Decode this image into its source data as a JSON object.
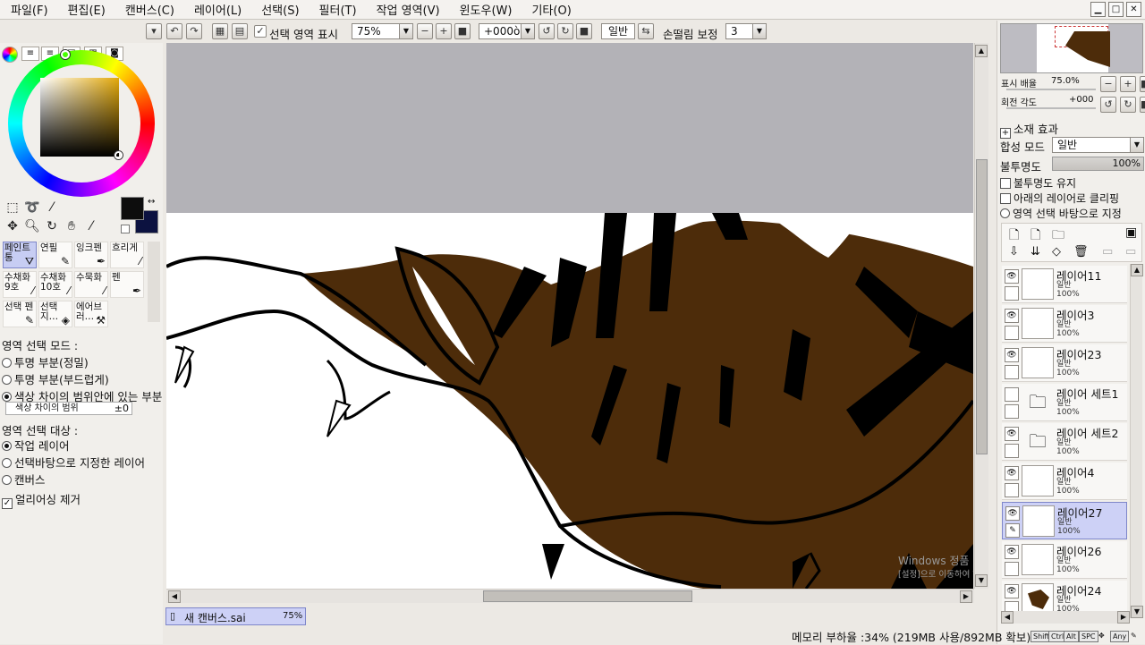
{
  "menu": [
    "파일(F)",
    "편집(E)",
    "캔버스(C)",
    "레이어(L)",
    "선택(S)",
    "필터(T)",
    "작업 영역(V)",
    "윈도우(W)",
    "기타(O)"
  ],
  "toolbar": {
    "show_selection_label": "선택 영역 표시",
    "zoom_value": "75%",
    "rotation_value": "+000ò",
    "blend_value": "일반",
    "stabilizer_label": "손떨림 보정",
    "stabilizer_value": "3"
  },
  "tools": {
    "brushes": [
      {
        "label": "페인트통",
        "icon": "bucket-icon"
      },
      {
        "label": "연필",
        "icon": "pencil-icon"
      },
      {
        "label": "잉크펜",
        "icon": "pen-icon"
      },
      {
        "label": "흐리게",
        "icon": "blur-icon"
      },
      {
        "label": "수채화 9호",
        "icon": "brush-icon"
      },
      {
        "label": "수채화 10호",
        "icon": "brush-icon"
      },
      {
        "label": "수묵화",
        "icon": "brush-icon"
      },
      {
        "label": "펜",
        "icon": "pen-icon"
      },
      {
        "label": "선택 펜",
        "icon": "selpen-icon"
      },
      {
        "label": "선택 지…",
        "icon": "eraser-icon"
      },
      {
        "label": "에어브러…",
        "icon": "airbrush-icon"
      }
    ],
    "selection_mode_title": "영역 선택 모드 :",
    "selection_modes": [
      "투명 부분(정밀)",
      "투명 부분(부드럽게)",
      "색상 차이의 범위안에 있는 부분"
    ],
    "color_range_label": "색상 차이의 범위",
    "color_range_value": "±0",
    "selection_target_title": "영역 선택 대상 :",
    "selection_targets": [
      "작업 레이어",
      "선택바탕으로 지정한 레이어",
      "캔버스"
    ],
    "antialias_label": "얼리어싱 제거"
  },
  "navigator": {
    "zoom_label": "표시 배율",
    "zoom_value": "75.0%",
    "rotation_label": "회전 각도",
    "rotation_value": "+000"
  },
  "layer_panel": {
    "material_effect": "소재 효과",
    "blend_label": "합성 모드",
    "blend_value": "일반",
    "opacity_label": "불투명도",
    "opacity_value": "100%",
    "opt_preserve": "불투명도 유지",
    "opt_clip": "아래의 레이어로 클리핑",
    "opt_source": "영역 선택 바탕으로 지정",
    "layers": [
      {
        "name": "레이어11",
        "mode": "일반",
        "opacity": "100%",
        "visible": true,
        "folder": false
      },
      {
        "name": "레이어3",
        "mode": "일반",
        "opacity": "100%",
        "visible": true,
        "folder": false
      },
      {
        "name": "레이어23",
        "mode": "일반",
        "opacity": "100%",
        "visible": true,
        "folder": false
      },
      {
        "name": "레이어 세트1",
        "mode": "일반",
        "opacity": "100%",
        "visible": false,
        "folder": true
      },
      {
        "name": "레이어 세트2",
        "mode": "일반",
        "opacity": "100%",
        "visible": true,
        "folder": true
      },
      {
        "name": "레이어4",
        "mode": "일반",
        "opacity": "100%",
        "visible": true,
        "folder": false
      },
      {
        "name": "레이어27",
        "mode": "일반",
        "opacity": "100%",
        "visible": true,
        "folder": false
      },
      {
        "name": "레이어26",
        "mode": "일반",
        "opacity": "100%",
        "visible": true,
        "folder": false
      },
      {
        "name": "레이어24",
        "mode": "일반",
        "opacity": "100%",
        "visible": true,
        "folder": false
      }
    ]
  },
  "document_tab": {
    "name": "새 캔버스.sai",
    "zoom": "75%"
  },
  "status": {
    "memory": "메모리 부하율 :34% (219MB 사용/892MB 확보)",
    "keys": [
      "Shift",
      "Ctrl",
      "Alt",
      "SPC",
      "Any"
    ]
  },
  "watermark": {
    "line1": "Windows 정품 인증",
    "line2": "[설정]으로 이동하여 Windows를 정품 인증합니다."
  },
  "colors": {
    "fur": "#4d2c0a",
    "accent": "#cdd1f6",
    "primary_color": "#0d0d0d",
    "secondary_color": "#0c1240"
  }
}
